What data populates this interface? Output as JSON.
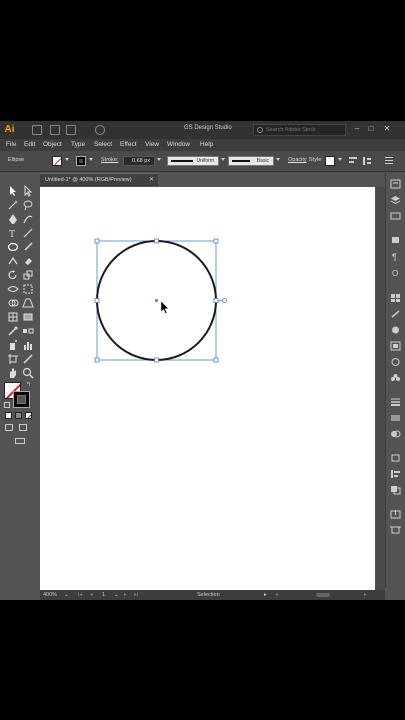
{
  "app": {
    "logo": "Ai",
    "workspace": "GS Design Studio",
    "search_placeholder": "Search Adobe Stock",
    "window_controls": [
      "–",
      "□",
      "✕"
    ]
  },
  "menu": [
    "File",
    "Edit",
    "Object",
    "Type",
    "Select",
    "Effect",
    "View",
    "Window",
    "Help"
  ],
  "control_bar": {
    "selection_type": "Ellipse",
    "stroke_label": "Stroke:",
    "stroke_weight": "0.68 px",
    "profile": "Uniform",
    "brush": "Basic",
    "opacity_label": "Opacity",
    "style_label": "Style:"
  },
  "document": {
    "tab_title": "Untitled-1* @ 400% (RGB/Preview)",
    "close": "✕"
  },
  "status_bar": {
    "zoom": "400%",
    "artboard_number": "1",
    "tool": "Selection"
  },
  "canvas": {
    "ellipse_stroke_color": "#1a1a1a",
    "bounding_box_color": "#4a7fd4",
    "artboard_color": "#ffffff"
  },
  "colors": {
    "app_bg": "#535353",
    "accent_logo": "#ff9a00"
  }
}
